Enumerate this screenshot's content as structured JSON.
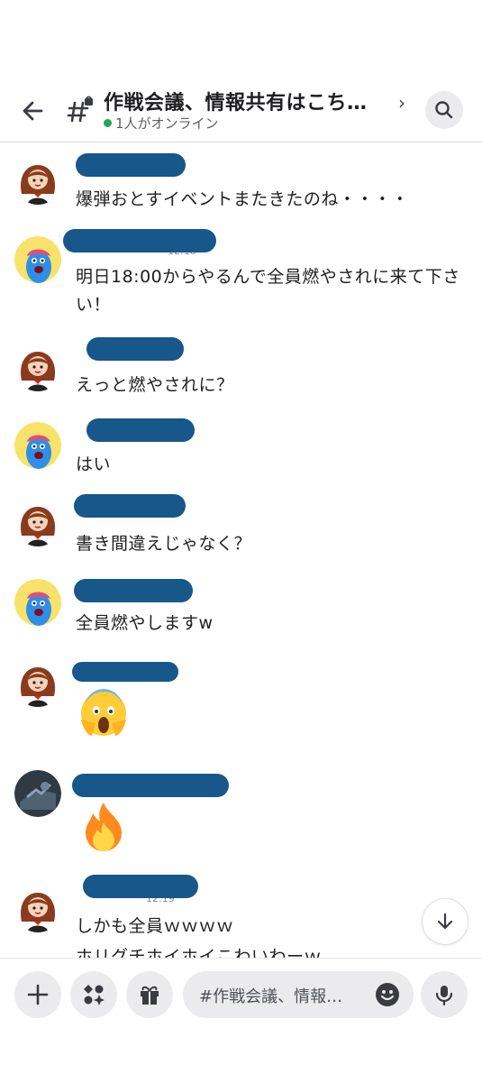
{
  "header": {
    "title": "作戦会議、情報共有はこち…",
    "subtitle": "1人がオンライン"
  },
  "messages": [
    {
      "name": "",
      "time": "",
      "text": "爆弾おとすイベントまたきたのね・・・・",
      "avatar": "woman-avatar"
    },
    {
      "name": "",
      "time": "12:18",
      "text": "明日18:00からやるんで全員燃やされに来て下さい！",
      "avatar": "blue-monster-avatar"
    },
    {
      "name": "",
      "time": "",
      "text": "えっと燃やされに？",
      "avatar": "woman-avatar"
    },
    {
      "name": "",
      "time": "",
      "text": "はい",
      "avatar": "blue-monster-avatar"
    },
    {
      "name": "",
      "time": "",
      "text": "書き間違えじゃなく？",
      "avatar": "woman-avatar"
    },
    {
      "name": "",
      "time": "",
      "text": "全員燃やしますw",
      "avatar": "blue-monster-avatar"
    },
    {
      "name": "",
      "time": "",
      "text": "",
      "emoji": "screaming-face-emoji",
      "avatar": "woman-avatar"
    },
    {
      "name": "",
      "time": "",
      "text": "",
      "emoji": "fire-emoji",
      "avatar": "photo-avatar"
    },
    {
      "name": "",
      "time": "12:19",
      "text": "しかも全員ｗｗｗｗ",
      "text2": "ホリグチホイホイこわいわーｗ",
      "avatar": "woman-avatar"
    }
  ],
  "composer": {
    "placeholder": "#作戦会議、情報…"
  },
  "icons": {
    "back": "back-arrow-icon",
    "channel": "locked-hash-icon",
    "search": "search-icon",
    "plus": "plus-icon",
    "apps": "apps-icon",
    "gift": "gift-icon",
    "emoji": "emoji-icon",
    "mic": "microphone-icon",
    "scroll": "arrow-down-icon"
  },
  "colors": {
    "online": "#23a55a",
    "redaction": "#17578a",
    "background": "#ffffff"
  }
}
